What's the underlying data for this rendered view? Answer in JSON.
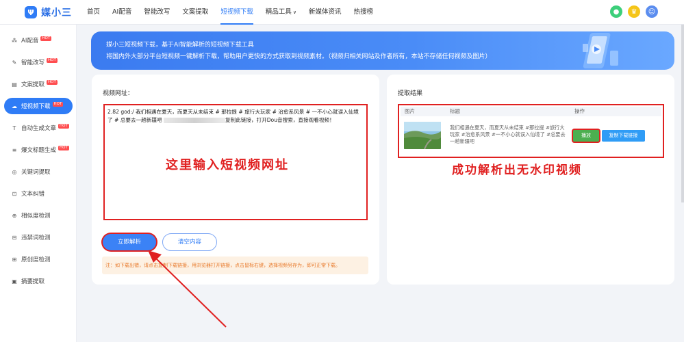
{
  "app": {
    "logo_mark": "Ψ",
    "logo_text": "媒小三"
  },
  "nav": [
    {
      "label": "首页",
      "active": false
    },
    {
      "label": "AI配音",
      "active": false
    },
    {
      "label": "智能改写",
      "active": false
    },
    {
      "label": "文案提取",
      "active": false
    },
    {
      "label": "短视频下载",
      "active": true
    },
    {
      "label": "精品工具",
      "active": false,
      "dropdown": true
    },
    {
      "label": "新媒体资讯",
      "active": false
    },
    {
      "label": "热搜榜",
      "active": false
    }
  ],
  "nav_icons": [
    {
      "name": "bell-icon",
      "color": "#3ccf7a",
      "glyph": "●"
    },
    {
      "name": "vip-crown-icon",
      "color": "#f5c518",
      "glyph": "♛"
    },
    {
      "name": "user-avatar-icon",
      "color": "#5b8def",
      "glyph": "☺"
    }
  ],
  "sidebar": {
    "hot_badge": "HOT",
    "items": [
      {
        "label": "AI配音",
        "icon": "waveform-icon",
        "glyph": "⁂",
        "hot": true,
        "active": false
      },
      {
        "label": "智能改写",
        "icon": "edit-icon",
        "glyph": "✎",
        "hot": true,
        "active": false
      },
      {
        "label": "文案提取",
        "icon": "document-icon",
        "glyph": "▤",
        "hot": true,
        "active": false
      },
      {
        "label": "短视频下载",
        "icon": "cloud-download-icon",
        "glyph": "☁",
        "hot": true,
        "active": true
      },
      {
        "label": "自动生成文章",
        "icon": "text-icon",
        "glyph": "T",
        "hot": true,
        "active": false
      },
      {
        "label": "爆文标题生成",
        "icon": "title-icon",
        "glyph": "≡",
        "hot": true,
        "active": false
      },
      {
        "label": "关键词提取",
        "icon": "keyword-icon",
        "glyph": "◎",
        "hot": false,
        "active": false
      },
      {
        "label": "文本纠错",
        "icon": "lock-icon",
        "glyph": "⊡",
        "hot": false,
        "active": false
      },
      {
        "label": "相似度检测",
        "icon": "similarity-icon",
        "glyph": "⊕",
        "hot": false,
        "active": false
      },
      {
        "label": "违禁词检测",
        "icon": "forbidden-word-icon",
        "glyph": "⊟",
        "hot": false,
        "active": false
      },
      {
        "label": "原创度检测",
        "icon": "originality-icon",
        "glyph": "⊞",
        "hot": false,
        "active": false
      },
      {
        "label": "摘要提取",
        "icon": "summary-icon",
        "glyph": "▣",
        "hot": false,
        "active": false
      }
    ]
  },
  "banner": {
    "line1": "媒小三短视频下载，基于AI智能解析的短视频下载工具",
    "line2": "将国内外大部分平台短视频一键解析下载，帮助用户更快的方式获取到视频素材。（视频归相关网站及作者所有，本站不存储任何视频及图片）"
  },
  "input": {
    "label": "视频网址：",
    "text_before": "2.82 god:/ 我们相遇在夏天，而夏天从未结束 # 那拉提 # 旅行大玩家 # 治愈系风景 # 一不小心就误入仙境了 # 总要去一趟新疆吧 ",
    "text_after": "复制此链接，打开Dou音搜索，直接观看视频！",
    "annotation": "这里输入短视频网址"
  },
  "buttons": {
    "parse": "立即解析",
    "clear": "清空内容"
  },
  "note": "注：如下载出错，请点击复制下载链接，用浏览器打开链接，点击鼠标右键，选择视频另存为，即可正常下载。",
  "result": {
    "label": "提取结果",
    "headers": {
      "image": "图片",
      "title": "标题",
      "action": "操作"
    },
    "title": "我们相遇在夏天，而夏天从未结束 #那拉提 #旅行大玩家 #治愈系风景 #一不小心就误入仙境了 #总要去一趟新疆吧",
    "play": "播放",
    "copy": "复制下载链接",
    "annotation": "成功解析出无水印视频"
  }
}
